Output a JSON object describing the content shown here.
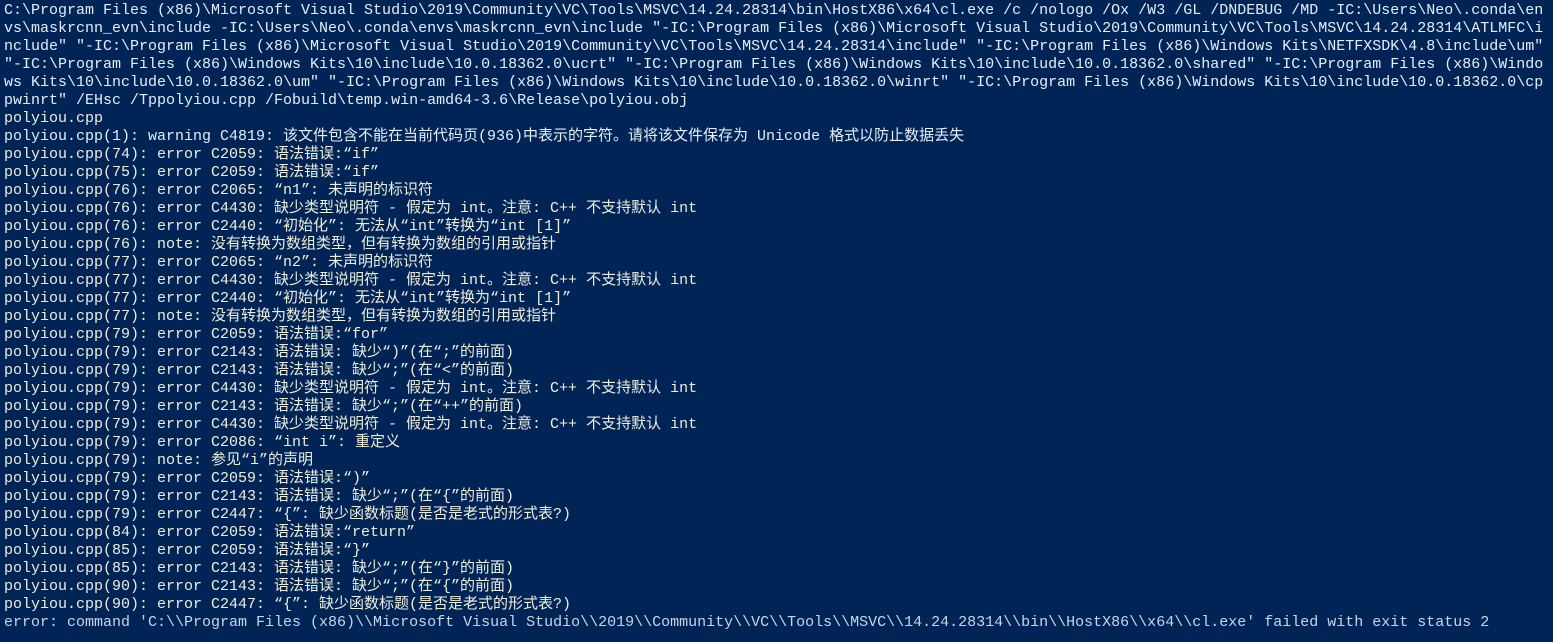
{
  "terminal": {
    "command": "C:\\Program Files (x86)\\Microsoft Visual Studio\\2019\\Community\\VC\\Tools\\MSVC\\14.24.28314\\bin\\HostX86\\x64\\cl.exe /c /nologo /Ox /W3 /GL /DNDEBUG /MD -IC:\\Users\\Neo\\.conda\\envs\\maskrcnn_evn\\include -IC:\\Users\\Neo\\.conda\\envs\\maskrcnn_evn\\include \"-IC:\\Program Files (x86)\\Microsoft Visual Studio\\2019\\Community\\VC\\Tools\\MSVC\\14.24.28314\\ATLMFC\\include\" \"-IC:\\Program Files (x86)\\Microsoft Visual Studio\\2019\\Community\\VC\\Tools\\MSVC\\14.24.28314\\include\" \"-IC:\\Program Files (x86)\\Windows Kits\\NETFXSDK\\4.8\\include\\um\" \"-IC:\\Program Files (x86)\\Windows Kits\\10\\include\\10.0.18362.0\\ucrt\" \"-IC:\\Program Files (x86)\\Windows Kits\\10\\include\\10.0.18362.0\\shared\" \"-IC:\\Program Files (x86)\\Windows Kits\\10\\include\\10.0.18362.0\\um\" \"-IC:\\Program Files (x86)\\Windows Kits\\10\\include\\10.0.18362.0\\winrt\" \"-IC:\\Program Files (x86)\\Windows Kits\\10\\include\\10.0.18362.0\\cppwinrt\" /EHsc /Tppolyiou.cpp /Fobuild\\temp.win-amd64-3.6\\Release\\polyiou.obj",
    "source_file": "polyiou.cpp",
    "lines": [
      "polyiou.cpp(1): warning C4819: 该文件包含不能在当前代码页(936)中表示的字符。请将该文件保存为 Unicode 格式以防止数据丢失",
      "polyiou.cpp(74): error C2059: 语法错误:“if”",
      "polyiou.cpp(75): error C2059: 语法错误:“if”",
      "polyiou.cpp(76): error C2065: “n1”: 未声明的标识符",
      "polyiou.cpp(76): error C4430: 缺少类型说明符 - 假定为 int。注意: C++ 不支持默认 int",
      "polyiou.cpp(76): error C2440: “初始化”: 无法从“int”转换为“int [1]”",
      "polyiou.cpp(76): note: 没有转换为数组类型，但有转换为数组的引用或指针",
      "polyiou.cpp(77): error C2065: “n2”: 未声明的标识符",
      "polyiou.cpp(77): error C4430: 缺少类型说明符 - 假定为 int。注意: C++ 不支持默认 int",
      "polyiou.cpp(77): error C2440: “初始化”: 无法从“int”转换为“int [1]”",
      "polyiou.cpp(77): note: 没有转换为数组类型，但有转换为数组的引用或指针",
      "polyiou.cpp(79): error C2059: 语法错误:“for”",
      "polyiou.cpp(79): error C2143: 语法错误: 缺少“)”(在“;”的前面)",
      "polyiou.cpp(79): error C2143: 语法错误: 缺少“;”(在“<”的前面)",
      "polyiou.cpp(79): error C4430: 缺少类型说明符 - 假定为 int。注意: C++ 不支持默认 int",
      "polyiou.cpp(79): error C2143: 语法错误: 缺少“;”(在“++”的前面)",
      "polyiou.cpp(79): error C4430: 缺少类型说明符 - 假定为 int。注意: C++ 不支持默认 int",
      "polyiou.cpp(79): error C2086: “int i”: 重定义",
      "polyiou.cpp(79): note: 参见“i”的声明",
      "polyiou.cpp(79): error C2059: 语法错误:“)”",
      "polyiou.cpp(79): error C2143: 语法错误: 缺少“;”(在“{”的前面)",
      "polyiou.cpp(79): error C2447: “{”: 缺少函数标题(是否是老式的形式表?)",
      "polyiou.cpp(84): error C2059: 语法错误:“return”",
      "polyiou.cpp(85): error C2059: 语法错误:“}”",
      "polyiou.cpp(85): error C2143: 语法错误: 缺少“;”(在“}”的前面)",
      "polyiou.cpp(90): error C2143: 语法错误: 缺少“;”(在“{”的前面)",
      "polyiou.cpp(90): error C2447: “{”: 缺少函数标题(是否是老式的形式表?)"
    ],
    "final_error": "error: command 'C:\\\\Program Files (x86)\\\\Microsoft Visual Studio\\\\2019\\\\Community\\\\VC\\\\Tools\\\\MSVC\\\\14.24.28314\\\\bin\\\\HostX86\\\\x64\\\\cl.exe' failed with exit status 2"
  }
}
